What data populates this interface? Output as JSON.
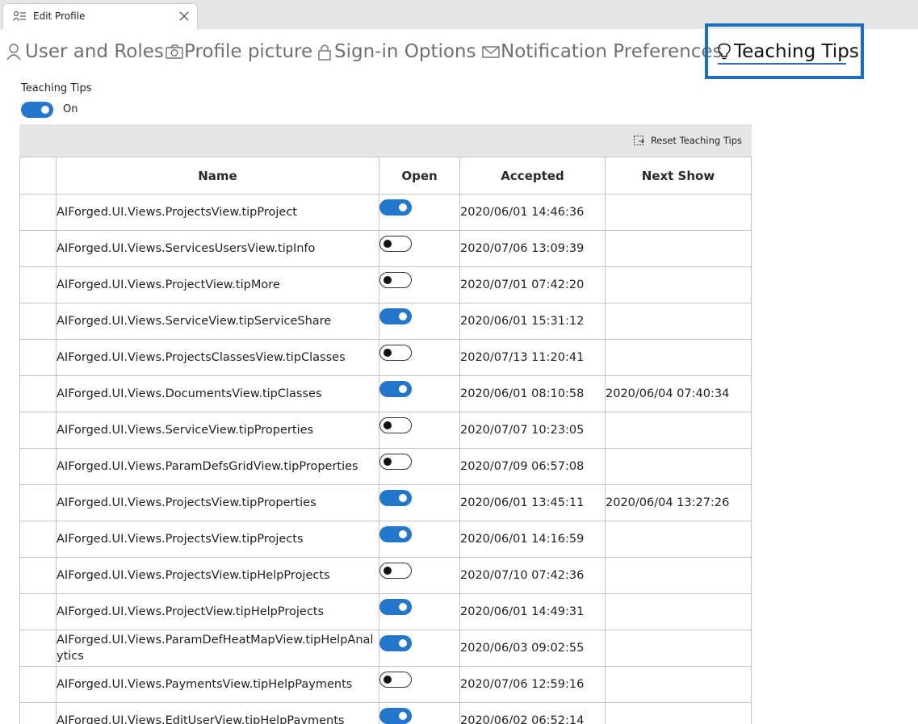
{
  "window": {
    "title": "Edit Profile"
  },
  "tabs": [
    {
      "label": "User and Roles",
      "icon": "user-icon"
    },
    {
      "label": "Profile picture",
      "icon": "camera-icon"
    },
    {
      "label": "Sign-in Options",
      "icon": "lock-icon"
    },
    {
      "label": "Notification Preferences",
      "icon": "envelope-icon"
    },
    {
      "label": "Teaching Tips",
      "icon": "lightbulb-icon",
      "active": true
    }
  ],
  "teaching_tips": {
    "label": "Teaching Tips",
    "enabled": true,
    "state_label": "On"
  },
  "toolbar": {
    "reset_label": "Reset Teaching Tips"
  },
  "colors": {
    "accent": "#2277cc",
    "focus_border": "#1a6fc4",
    "toolbar_bg": "#e6e6e6"
  },
  "table": {
    "columns": [
      "",
      "Name",
      "Open",
      "Accepted",
      "Next Show"
    ],
    "rows": [
      {
        "name": "AIForged.UI.Views.ProjectsView.tipProject",
        "open": true,
        "accepted": "2020/06/01 14:46:36",
        "next_show": ""
      },
      {
        "name": "AIForged.UI.Views.ServicesUsersView.tipInfo",
        "open": false,
        "accepted": "2020/07/06 13:09:39",
        "next_show": ""
      },
      {
        "name": "AIForged.UI.Views.ProjectView.tipMore",
        "open": false,
        "accepted": "2020/07/01 07:42:20",
        "next_show": ""
      },
      {
        "name": "AIForged.UI.Views.ServiceView.tipServiceShare",
        "open": true,
        "accepted": "2020/06/01 15:31:12",
        "next_show": ""
      },
      {
        "name": "AIForged.UI.Views.ProjectsClassesView.tipClasses",
        "open": false,
        "accepted": "2020/07/13 11:20:41",
        "next_show": ""
      },
      {
        "name": "AIForged.UI.Views.DocumentsView.tipClasses",
        "open": true,
        "accepted": "2020/06/01 08:10:58",
        "next_show": "2020/06/04 07:40:34"
      },
      {
        "name": "AIForged.UI.Views.ServiceView.tipProperties",
        "open": false,
        "accepted": "2020/07/07 10:23:05",
        "next_show": ""
      },
      {
        "name": "AIForged.UI.Views.ParamDefsGridView.tipProperties",
        "open": false,
        "accepted": "2020/07/09 06:57:08",
        "next_show": ""
      },
      {
        "name": "AIForged.UI.Views.ProjectsView.tipProperties",
        "open": true,
        "accepted": "2020/06/01 13:45:11",
        "next_show": "2020/06/04 13:27:26"
      },
      {
        "name": "AIForged.UI.Views.ProjectsView.tipProjects",
        "open": true,
        "accepted": "2020/06/01 14:16:59",
        "next_show": ""
      },
      {
        "name": "AIForged.UI.Views.ProjectsView.tipHelpProjects",
        "open": false,
        "accepted": "2020/07/10 07:42:36",
        "next_show": ""
      },
      {
        "name": "AIForged.UI.Views.ProjectView.tipHelpProjects",
        "open": true,
        "accepted": "2020/06/01 14:49:31",
        "next_show": ""
      },
      {
        "name": "AIForged.UI.Views.ParamDefHeatMapView.tipHelpAnalytics",
        "open": true,
        "accepted": "2020/06/03 09:02:55",
        "next_show": ""
      },
      {
        "name": "AIForged.UI.Views.PaymentsView.tipHelpPayments",
        "open": false,
        "accepted": "2020/07/06 12:59:16",
        "next_show": ""
      },
      {
        "name": "AIForged.UI.Views.EditUserView.tipHelpPayments",
        "open": true,
        "accepted": "2020/06/02 06:52:14",
        "next_show": ""
      }
    ]
  }
}
